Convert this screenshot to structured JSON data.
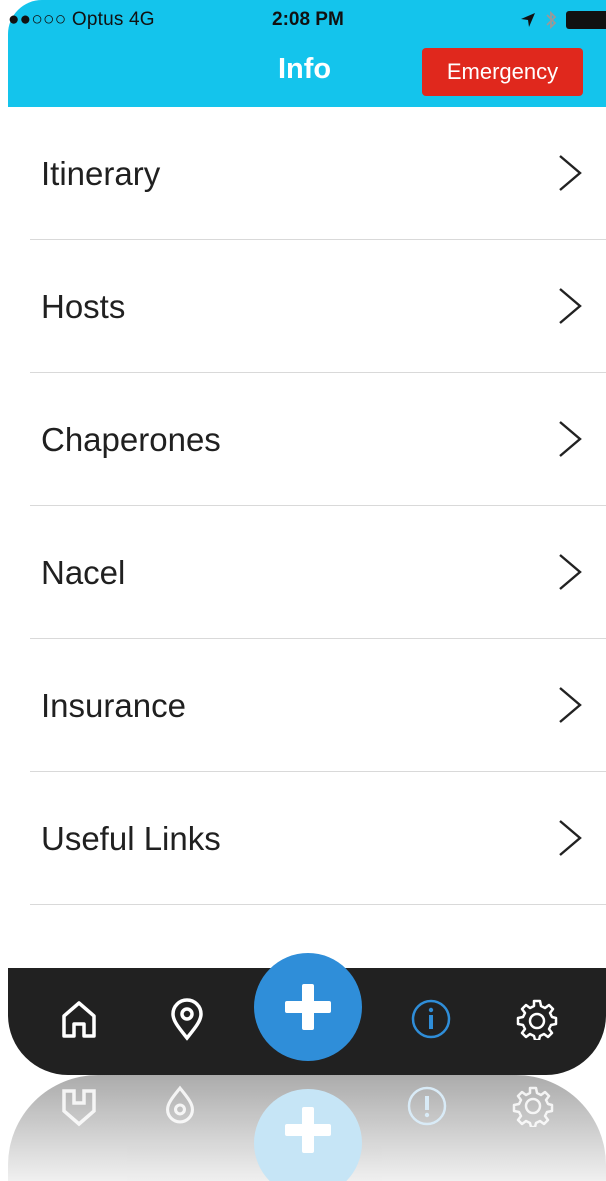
{
  "status_bar": {
    "carrier": "●●○○○ Optus  4G",
    "time": "2:08 PM",
    "location_icon": "location-arrow-icon",
    "bluetooth_icon": "bluetooth-icon",
    "battery_icon": "battery-icon"
  },
  "nav": {
    "title": "Info",
    "emergency_label": "Emergency"
  },
  "list": {
    "items": [
      {
        "label": "Itinerary"
      },
      {
        "label": "Hosts"
      },
      {
        "label": "Chaperones"
      },
      {
        "label": "Nacel"
      },
      {
        "label": "Insurance"
      },
      {
        "label": "Useful Links"
      }
    ]
  },
  "tabbar": {
    "tabs": [
      {
        "name": "home",
        "icon": "home-icon"
      },
      {
        "name": "location",
        "icon": "location-pin-icon"
      },
      {
        "name": "add",
        "icon": "plus-icon"
      },
      {
        "name": "info",
        "icon": "info-icon",
        "active": true
      },
      {
        "name": "settings",
        "icon": "gear-icon"
      }
    ]
  },
  "colors": {
    "header": "#14c4ec",
    "emergency": "#e0281d",
    "tabbar": "#212121",
    "accent": "#2f8ed9"
  }
}
